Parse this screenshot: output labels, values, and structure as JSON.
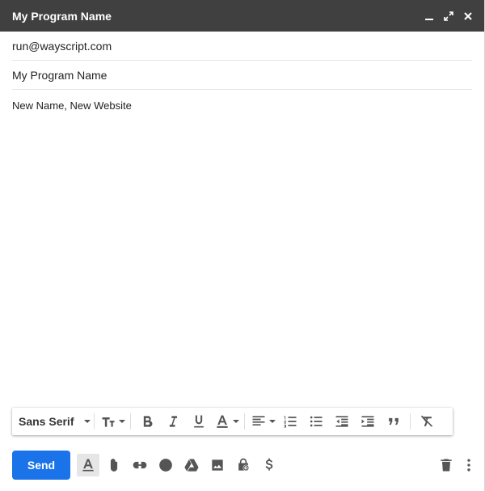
{
  "window": {
    "title": "My Program Name",
    "controls": [
      "minimize-icon",
      "expand-icon",
      "close-icon"
    ]
  },
  "compose": {
    "to": "run@wayscript.com",
    "subject": "My Program Name",
    "body": "New Name, New Website"
  },
  "formatting": {
    "font": "Sans Serif",
    "tools": [
      "text-size-icon",
      "bold-icon",
      "italic-icon",
      "underline-icon",
      "text-color-icon",
      "align-icon",
      "numbered-list-icon",
      "bulleted-list-icon",
      "indent-less-icon",
      "indent-more-icon",
      "quote-icon",
      "remove-formatting-icon"
    ]
  },
  "actions": {
    "send_label": "Send",
    "icons": [
      "formatting-options-icon",
      "attach-file-icon",
      "insert-link-icon",
      "emoji-icon",
      "drive-icon",
      "insert-photo-icon",
      "confidential-mode-icon",
      "dollar-icon",
      "discard-draft-icon",
      "more-options-icon"
    ]
  },
  "colors": {
    "titlebar": "#404040",
    "send_button": "#1a73e8"
  }
}
